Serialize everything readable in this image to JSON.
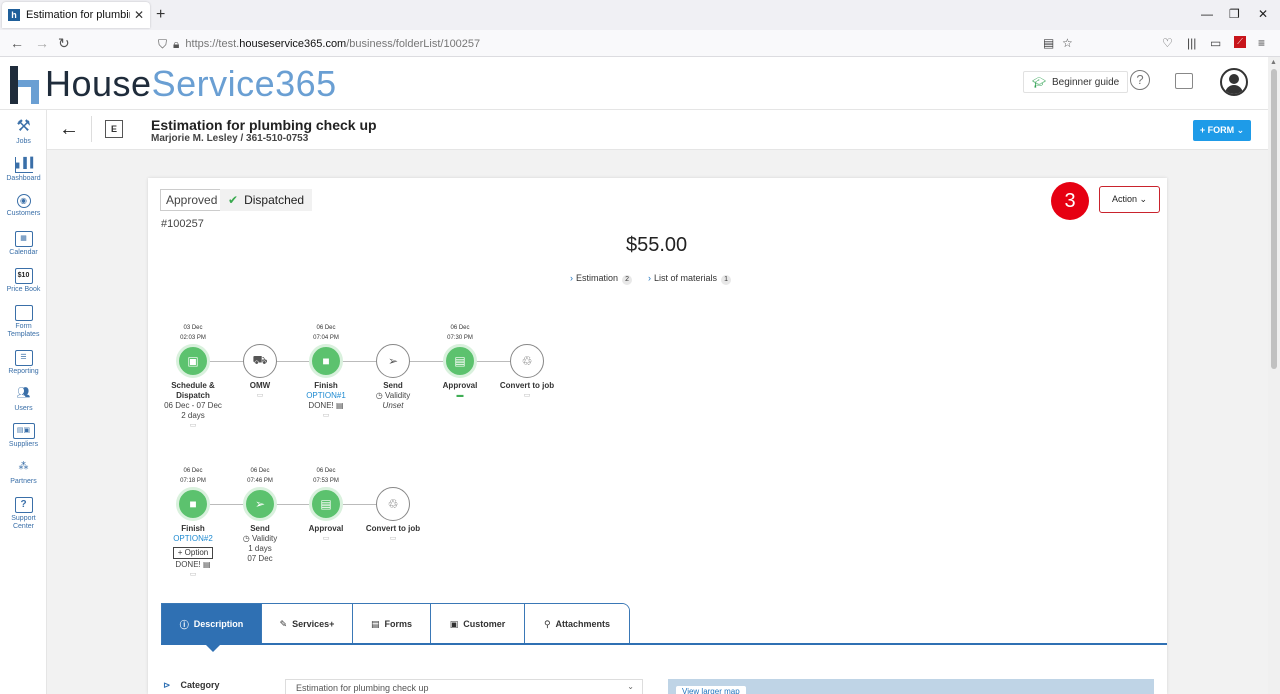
{
  "browser": {
    "tab_title": "Estimation for plumbing check",
    "url_prefix": "https://test.",
    "url_host": "houseservice365.com",
    "url_path": "/business/folderList/100257"
  },
  "header": {
    "logo_part1": "House",
    "logo_part2": "Service365",
    "beginner_guide": "Beginner guide",
    "help_icon": "?"
  },
  "sidebar": {
    "items": [
      {
        "label": "Jobs",
        "icon": "tools-icon"
      },
      {
        "label": "Dashboard",
        "icon": "chart-icon"
      },
      {
        "label": "Customers",
        "icon": "target-icon"
      },
      {
        "label": "Calendar",
        "icon": "calendar-icon"
      },
      {
        "label": "Price Book",
        "icon": "pricebook-icon",
        "glyph": "$10"
      },
      {
        "label": "Form",
        "label2": "Templates",
        "icon": "form-icon"
      },
      {
        "label": "Reporting",
        "icon": "reporting-icon"
      },
      {
        "label": "Users",
        "icon": "users-icon"
      },
      {
        "label": "Suppliers",
        "icon": "truck-icon"
      },
      {
        "label": "Partners",
        "icon": "partners-icon"
      },
      {
        "label": "Support",
        "label2": "Center",
        "icon": "support-icon",
        "glyph": "?"
      }
    ]
  },
  "page": {
    "badge": "E",
    "title": "Estimation for plumbing check up",
    "subtitle": "Marjorie M. Lesley / 361-510-0753",
    "form_button": "+ FORM ⌄"
  },
  "card": {
    "status_approved": "Approved",
    "status_dispatched": "Dispatched",
    "doc_number": "#100257",
    "step_badge": "3",
    "action_button": "Action ⌄",
    "amount": "$55.00",
    "links": [
      {
        "label": "Estimation",
        "count": "2"
      },
      {
        "label": "List of materials",
        "count": "1"
      }
    ]
  },
  "workflow_row1": [
    {
      "date": "03 Dec",
      "time": "02:03 PM",
      "name": "Schedule &",
      "name2": "Dispatch",
      "line1": "06 Dec - 07 Dec",
      "line2": "2 days"
    },
    {
      "name": "OMW"
    },
    {
      "date": "06 Dec",
      "time": "07:04 PM",
      "name": "Finish",
      "option": "OPTION#1",
      "done": "DONE!"
    },
    {
      "name": "Send",
      "validity": "Validity",
      "unset": "Unset"
    },
    {
      "date": "06 Dec",
      "time": "07:30 PM",
      "name": "Approval"
    },
    {
      "name": "Convert to job"
    }
  ],
  "workflow_row2": [
    {
      "date": "06 Dec",
      "time": "07:18 PM",
      "name": "Finish",
      "option": "OPTION#2",
      "add_option": "+ Option",
      "done": "DONE!"
    },
    {
      "date": "06 Dec",
      "time": "07:46 PM",
      "name": "Send",
      "validity": "Validity",
      "line1": "1 days",
      "line2": "07 Dec"
    },
    {
      "date": "06 Dec",
      "time": "07:53 PM",
      "name": "Approval"
    },
    {
      "name": "Convert to job"
    }
  ],
  "tabs": [
    "Description",
    "Services+",
    "Forms",
    "Customer",
    "Attachments"
  ],
  "details": {
    "category_label": "Category",
    "category_value": "Estimation for plumbing check up",
    "map_button": "View larger map"
  }
}
